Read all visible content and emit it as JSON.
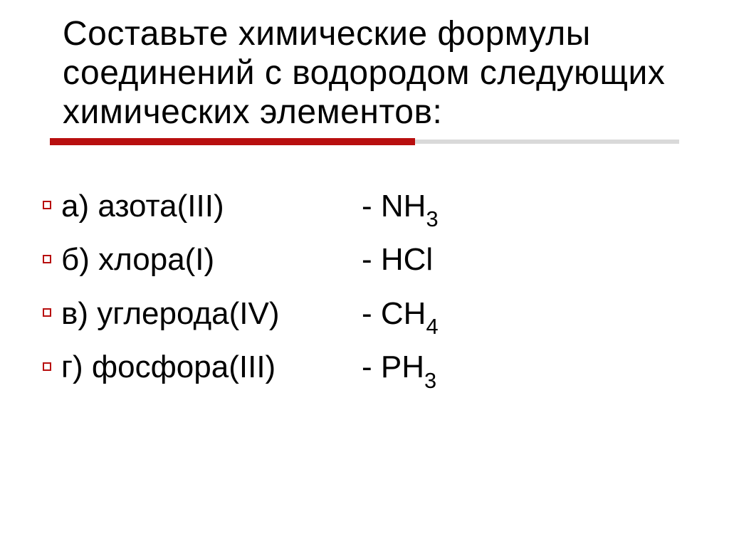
{
  "title": "Составьте  химические формулы соединений с водородом  следующих химических элементов:",
  "items": [
    {
      "label": "а) азота(III)",
      "formula_prefix": "- NH",
      "formula_sub": "3"
    },
    {
      "label": "б) хлора(I)",
      "formula_prefix": "- HCl",
      "formula_sub": ""
    },
    {
      "label": "в) углерода(IV)",
      "formula_prefix": "- CH",
      "formula_sub": "4"
    },
    {
      "label": "г) фосфора(III)",
      "formula_prefix": "- PH",
      "formula_sub": "3"
    }
  ]
}
